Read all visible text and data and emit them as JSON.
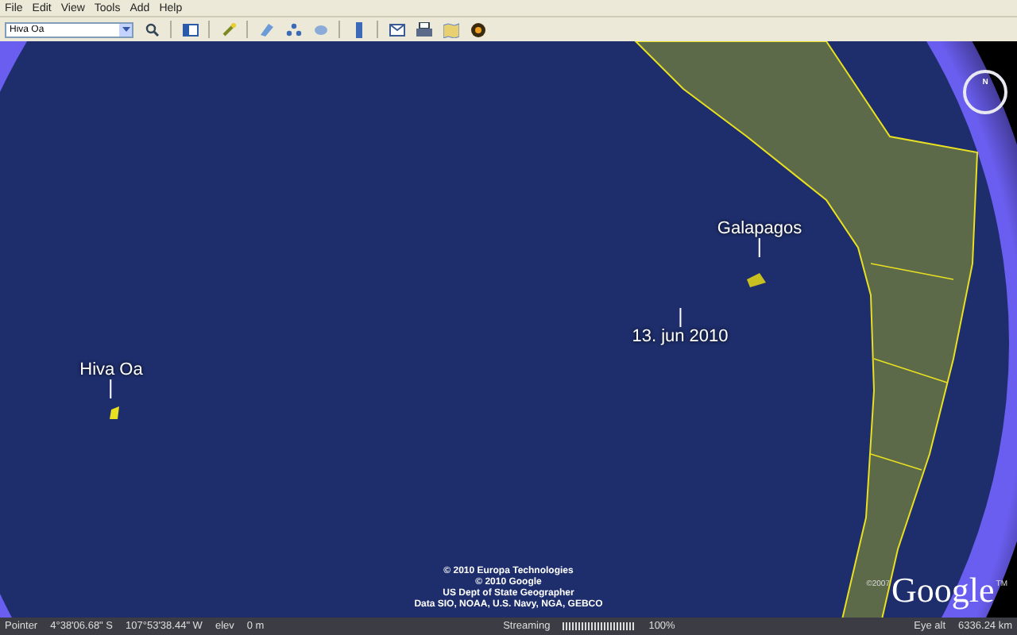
{
  "menu": [
    "File",
    "Edit",
    "View",
    "Tools",
    "Add",
    "Help"
  ],
  "search": {
    "value": "Hiva Oa"
  },
  "map": {
    "compass": {
      "north": "N"
    },
    "places": [
      {
        "label": "Galapagos",
        "kind": "above"
      },
      {
        "label": "13. jun 2010",
        "kind": "below"
      },
      {
        "label": "Hiva Oa",
        "kind": "above"
      }
    ],
    "attribution": [
      "© 2010 Europa Technologies",
      "© 2010 Google",
      "US Dept of State Geographer",
      "Data SIO, NOAA, U.S. Navy, NGA, GEBCO"
    ],
    "logo": {
      "copyright": "©2007",
      "name": "Google",
      "mark": "TM"
    }
  },
  "status": {
    "pointer_label": "Pointer",
    "latitude": "4°38'06.68\" S",
    "longitude": "107°53'38.44\" W",
    "elev_label": "elev",
    "elev": "0 m",
    "streaming_label": "Streaming",
    "streaming": {
      "level": 1
    },
    "streaming_percent": "100%",
    "eye_alt_label": "Eye alt",
    "eye_alt": "6336.24 km"
  }
}
